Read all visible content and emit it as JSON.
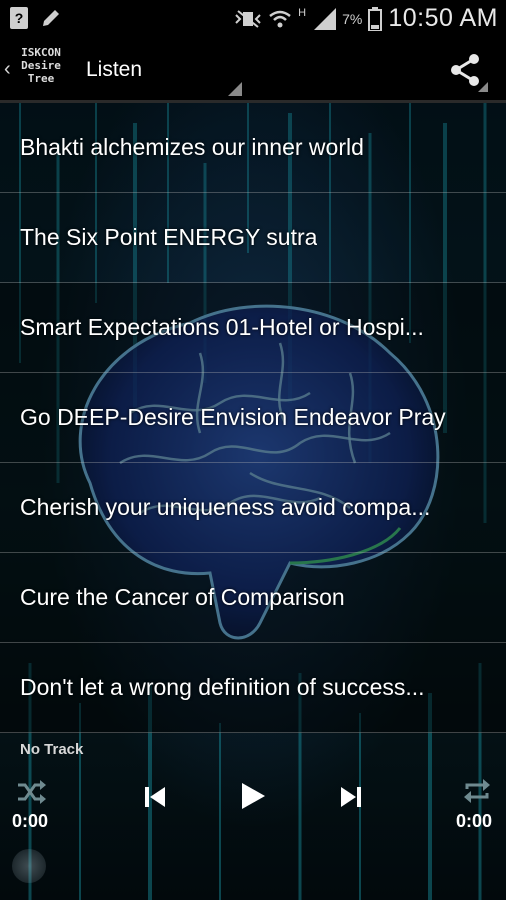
{
  "status_bar": {
    "battery_percent": "7%",
    "network_label": "H",
    "time": "10:50 AM"
  },
  "action_bar": {
    "logo_lines": [
      "ISKCON",
      "Desire",
      "Tree"
    ],
    "title": "Listen"
  },
  "tracks": [
    "Bhakti alchemizes our inner world",
    "The Six Point ENERGY sutra",
    "Smart Expectations 01-Hotel or Hospi...",
    "Go DEEP-Desire Envision Endeavor Pray",
    "Cherish your uniqueness avoid compa...",
    "Cure the Cancer of Comparison",
    "Don't let a wrong definition of success..."
  ],
  "player": {
    "track_label": "No Track",
    "elapsed": "0:00",
    "duration": "0:00"
  },
  "colors": {
    "background": "#000000",
    "accent_teal": "#1fb7c9",
    "brain_blue": "#2f5fc8",
    "divider": "#5a5a5a"
  }
}
